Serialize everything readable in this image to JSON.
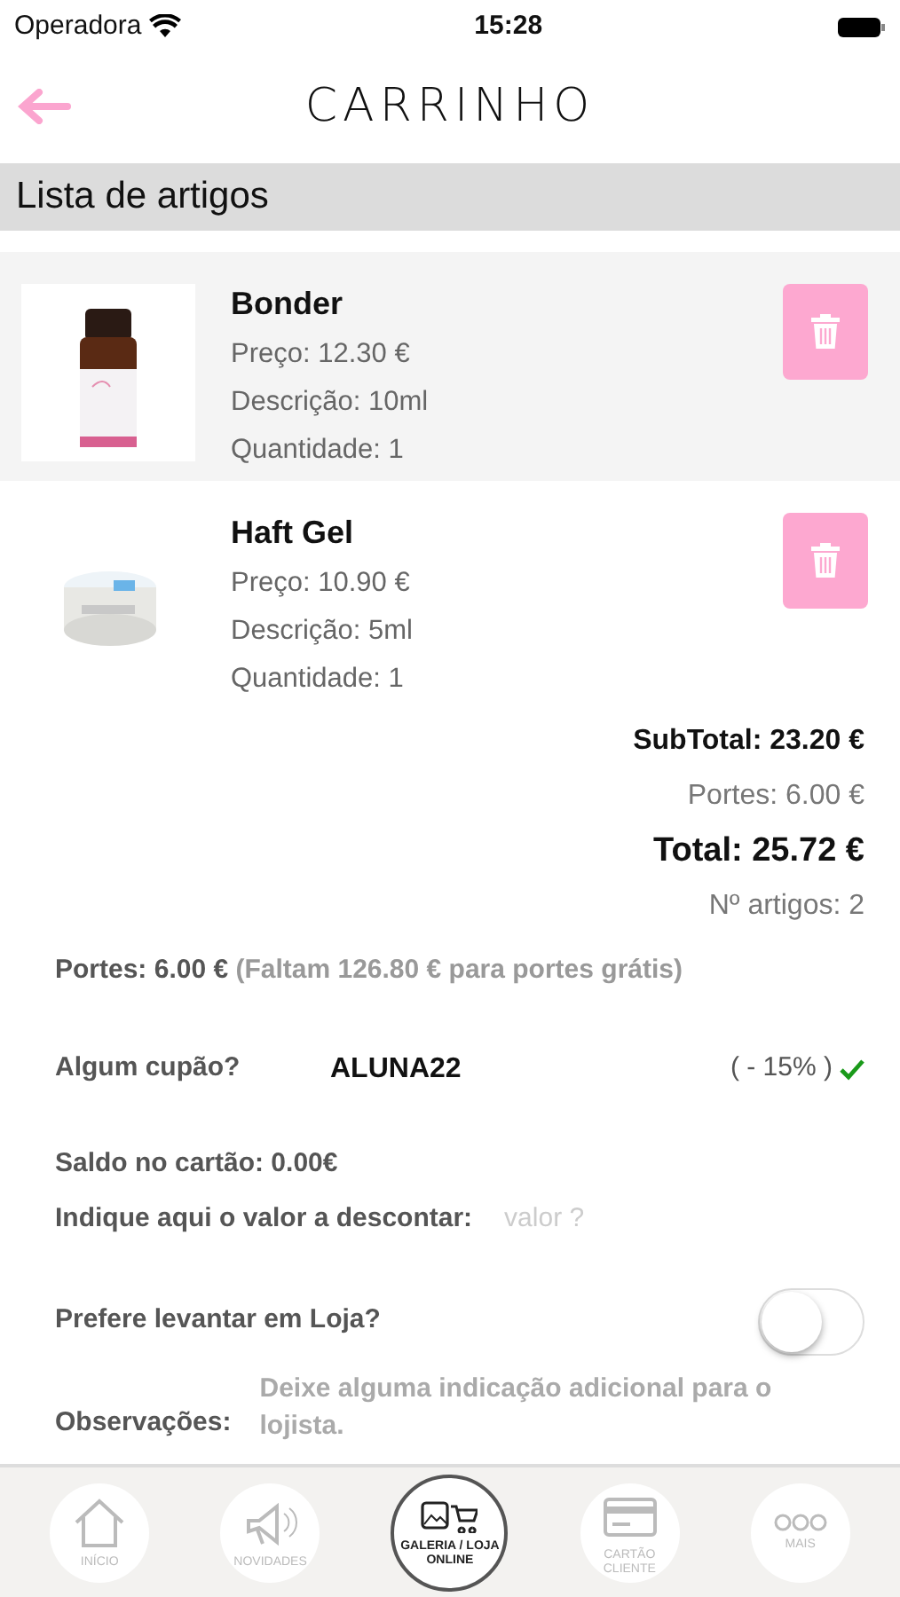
{
  "status_bar": {
    "carrier": "Operadora",
    "time": "15:28"
  },
  "header": {
    "title": "CARRINHO"
  },
  "section_title": "Lista de artigos",
  "items": [
    {
      "name": "Bonder",
      "price": "Preço: 12.30 €",
      "description": "Descrição: 10ml",
      "quantity": "Quantidade: 1",
      "kind": "picture"
    },
    {
      "name": "Haft Gel",
      "price": "Preço: 10.90 €",
      "description": "Descrição: 5ml",
      "quantity": "Quantidade: 1",
      "kind": "picture"
    }
  ],
  "totals": {
    "subtotal": "SubTotal: 23.20 €",
    "shipping": "Portes: 6.00 €",
    "total": "Total: 25.72 €",
    "count": "Nº artigos: 2"
  },
  "shipping_note": "**Portes: 6.00 €** (Faltam 126.80 € para portes grátis)",
  "coupon": {
    "label": "Algum cupão?",
    "code": "ALUNA22",
    "discount": "( - 15% )",
    "valid": true
  },
  "card_balance": "Saldo no cartão: 0.00€",
  "discount_input": {
    "label": "Indique aqui o valor a descontar:",
    "placeholder": "valor ?"
  },
  "store_pickup": {
    "label": "Prefere levantar em Loja?",
    "on": false
  },
  "notes": {
    "label": "Observações:",
    "placeholder": "Deixe alguma indicação adicional para o lojista."
  },
  "tab_bar": [
    {
      "label": "INÍCIO",
      "kind": "home",
      "selected": false
    },
    {
      "label": "NOVIDADES",
      "kind": "megaphone",
      "selected": false
    },
    {
      "label": "GALERIA / LOJA ONLINE",
      "kind": "gallery",
      "selected": true
    },
    {
      "label": "CARTÃO CLIENTE",
      "kind": "card",
      "selected": false
    },
    {
      "label": "MAIS",
      "kind": "more",
      "selected": false
    }
  ]
}
